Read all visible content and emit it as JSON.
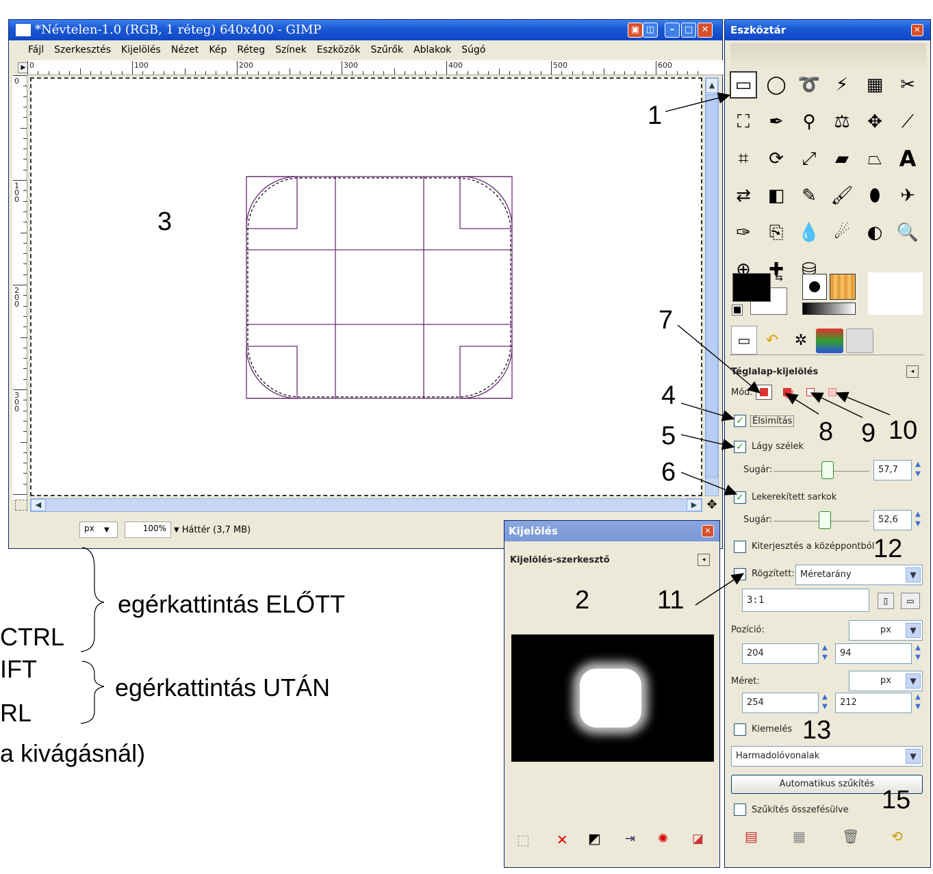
{
  "gimp_window": {
    "title": "*Névtelen-1.0 (RGB, 1 réteg) 640x400 - GIMP",
    "menu": [
      "Fájl",
      "Szerkesztés",
      "Kijelölés",
      "Nézet",
      "Kép",
      "Réteg",
      "Színek",
      "Eszközök",
      "Szűrők",
      "Ablakok",
      "Súgó"
    ],
    "ruler_h": [
      "0",
      "100",
      "200",
      "300",
      "400",
      "500",
      "600"
    ],
    "ruler_v": [
      "0",
      "1\n0\n0",
      "2\n0\n0",
      "3\n0\n0"
    ],
    "status": {
      "unit": "px",
      "zoom": "100%",
      "layer_info": "Háttér (3,7 MB)"
    }
  },
  "toolbox": {
    "title": "Eszköztár",
    "tool_options_title": "Téglalap-kijelölés",
    "mode_label": "Mód:",
    "antialias": "Élsimítás",
    "feather": "Lágy szélek",
    "feather_radius_label": "Sugár:",
    "feather_radius": "57,7",
    "rounded": "Lekerekített sarkok",
    "rounded_radius_label": "Sugár:",
    "rounded_radius": "52,6",
    "expand_center": "Kiterjesztés a középpontból",
    "fixed_label": "Rögzített:",
    "fixed_mode": "Méretarány",
    "fixed_value": "3:1",
    "position_label": "Pozíció:",
    "position_unit": "px",
    "position_x": "204",
    "position_y": "94",
    "size_label": "Méret:",
    "size_unit": "px",
    "size_w": "254",
    "size_h": "212",
    "highlight": "Kiemelés",
    "guides": "Harmadolóvonalak",
    "auto_shrink": "Automatikus szűkítés",
    "shrink_merged": "Szűkítés összefésülve"
  },
  "selection_dialog": {
    "title": "Kijelölés",
    "editor_title": "Kijelölés-szerkesztő"
  },
  "annotations": {
    "n1": "1",
    "n2": "2",
    "n3": "3",
    "n4": "4",
    "n5": "5",
    "n6": "6",
    "n7": "7",
    "n8": "8",
    "n9": "9",
    "n10": "10",
    "n11": "11",
    "n12": "12",
    "n13": "13",
    "n15": "15",
    "before_click": "egérkattintás ELŐTT",
    "after_click": "egérkattintás UTÁN",
    "ctrl1": "CTRL",
    "shift": "IFT",
    "ctrl2": "RL",
    "crop_note": "a kivágásnál)"
  },
  "colors": {
    "titlebar": "#0f47c4",
    "selection_line": "#6a2a74",
    "panel_bg": "#ece9d8"
  }
}
